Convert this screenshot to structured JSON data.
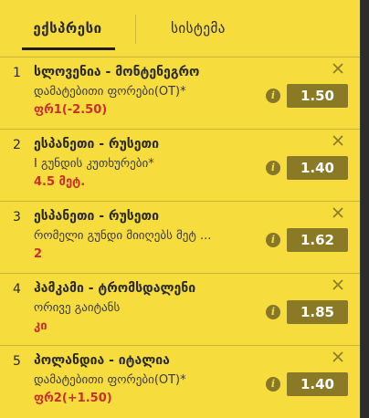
{
  "tabs": {
    "express": "ექსპრესი",
    "system": "სისტემა"
  },
  "bets": [
    {
      "num": "1",
      "teams": "სლოვენია - მონტენეგრო",
      "market": "დამატებითი ფორები(OT)*",
      "pick": "ფრ1(-2.50)",
      "odds": "1.50"
    },
    {
      "num": "2",
      "teams": "ესპანეთი - რუსეთი",
      "market": "I გუნდის კუთხურები*",
      "pick": "4.5 მეტ.",
      "odds": "1.40"
    },
    {
      "num": "3",
      "teams": "ესპანეთი - რუსეთი",
      "market": "რომელი გუნდი მიიღებს მეტ ...",
      "pick": "2",
      "odds": "1.62"
    },
    {
      "num": "4",
      "teams": "ჰამკამი - ტრომსდალენი",
      "market": "ორივე გაიტანს",
      "pick": "კი",
      "odds": "1.85"
    },
    {
      "num": "5",
      "teams": "პოლანდია - იტალია",
      "market": "დამატებითი ფორები(OT)*",
      "pick": "ფრ2(+1.50)",
      "odds": "1.40"
    }
  ],
  "icons": {
    "close": "close-icon",
    "info": "info-icon"
  },
  "colors": {
    "panel": "#f7dc3e",
    "odds_button": "#8a7a26",
    "pick_text": "#c9302c"
  }
}
